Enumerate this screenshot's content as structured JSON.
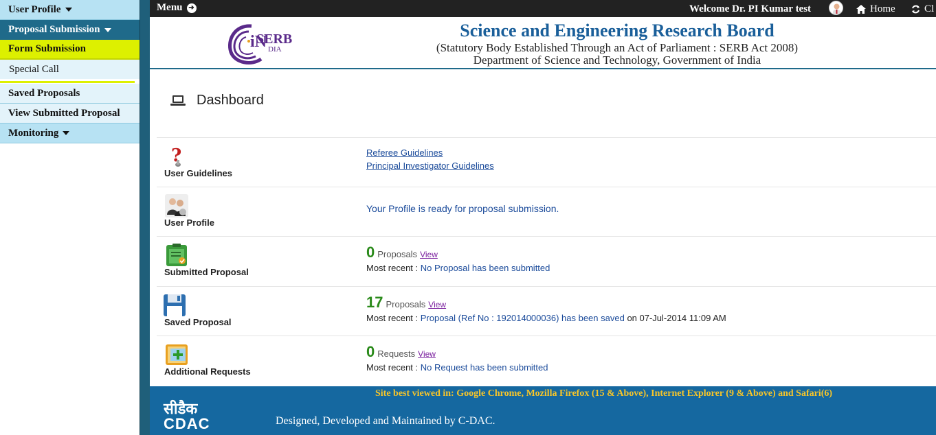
{
  "sidebar": {
    "items": [
      {
        "label": "User Profile",
        "has_caret": true
      },
      {
        "label": "Proposal Submission",
        "has_caret": true
      },
      {
        "label": "Form Submission"
      },
      {
        "label": "Special Call"
      },
      {
        "label": "Saved Proposals"
      },
      {
        "label": "View Submitted Proposal"
      },
      {
        "label": "Monitoring",
        "has_caret": true
      }
    ]
  },
  "topbar": {
    "menu_label": "Menu",
    "welcome": "Welcome Dr. PI Kumar test",
    "home_label": "Home",
    "refresh_label": "Cl"
  },
  "header": {
    "logo_text": "SERB",
    "logo_in": "iN",
    "logo_dia": "DIA",
    "title": "Science and Engineering Research Board",
    "subtitle": "(Statutory Body Established Through an Act of Parliament : SERB Act 2008)",
    "dept": "Department of Science and Technology, Government of India"
  },
  "dashboard": {
    "title": "Dashboard",
    "guidelines": {
      "label": "User Guidelines",
      "links": [
        "Referee Guidelines",
        "Principal Investigator Guidelines"
      ]
    },
    "profile": {
      "label": "User Profile",
      "message": "Your Profile is ready for proposal submission."
    },
    "submitted": {
      "label": "Submitted Proposal",
      "count": "0",
      "unit": "Proposals",
      "view": "View",
      "recent_label": "Most recent :",
      "recent_text": "No Proposal has been submitted"
    },
    "saved": {
      "label": "Saved Proposal",
      "count": "17",
      "unit": "Proposals",
      "view": "View",
      "recent_label": "Most recent :",
      "recent_text": "Proposal (Ref No : 192014000036) has been saved",
      "recent_date": "on 07-Jul-2014 11:09 AM"
    },
    "requests": {
      "label": "Additional Requests",
      "count": "0",
      "unit": "Requests",
      "view": "View",
      "recent_label": "Most recent :",
      "recent_text": "No Request has been submitted"
    }
  },
  "footer": {
    "best_viewed": "Site best viewed in: Google Chrome, Mozilla Firefox (15 & Above), Internet Explorer (9 & Above) and Safari(6)",
    "cdac_hindi": "सीडैक",
    "cdac_en": "CDAC",
    "designed": "Designed, Developed and Maintained by C-DAC."
  },
  "colors": {
    "sidebar_strip": "#1f5f7a",
    "sidebar_item": "#b7e2f3",
    "sidebar_active": "#ddf000",
    "title_blue": "#1a5f9a",
    "count_green": "#2a8a1a",
    "footer_blue": "#1568a0",
    "footer_gold": "#f6c52a"
  }
}
